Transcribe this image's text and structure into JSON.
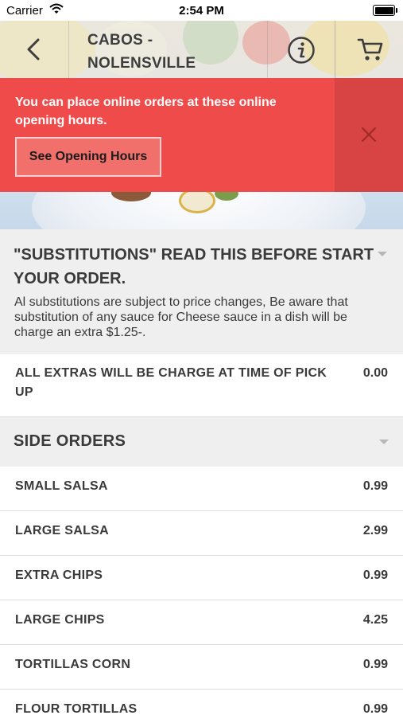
{
  "status_bar": {
    "carrier": "Carrier",
    "time": "2:54 PM"
  },
  "header": {
    "title_line1": "CABOS -",
    "title_line2": "NOLENSVILLE"
  },
  "banner": {
    "message": "You can place online orders at these online opening hours.",
    "button_label": "See Opening Hours"
  },
  "notice": {
    "heading": "\"SUBSTITUTIONS\" READ THIS BEFORE START YOUR ORDER.",
    "body": "Al substitutions are subject to price changes, Be aware that substitution of any sauce for Cheese sauce in a dish will be charge an extra $1.25-."
  },
  "extras_item": {
    "name": "ALL EXTRAS WILL BE CHARGE AT TIME OF PICK UP",
    "price": "0.00"
  },
  "side_orders": {
    "label": "SIDE ORDERS",
    "items": [
      {
        "name": "SMALL SALSA",
        "price": "0.99"
      },
      {
        "name": "LARGE SALSA",
        "price": "2.99"
      },
      {
        "name": "EXTRA CHIPS",
        "price": "0.99"
      },
      {
        "name": "LARGE CHIPS",
        "price": "4.25"
      },
      {
        "name": "TORTILLAS CORN",
        "price": "0.99"
      },
      {
        "name": "FLOUR TORTILLAS",
        "price": "0.99"
      }
    ]
  },
  "icons": {
    "back": "chevron-left-icon",
    "info": "info-icon",
    "cart": "cart-icon",
    "close": "close-icon",
    "expand": "caret-down-icon"
  },
  "colors": {
    "banner": "#ef4b4b",
    "banner_close_cell": "#d84444",
    "section_bg": "#efefef",
    "text": "#3a3a3a"
  }
}
